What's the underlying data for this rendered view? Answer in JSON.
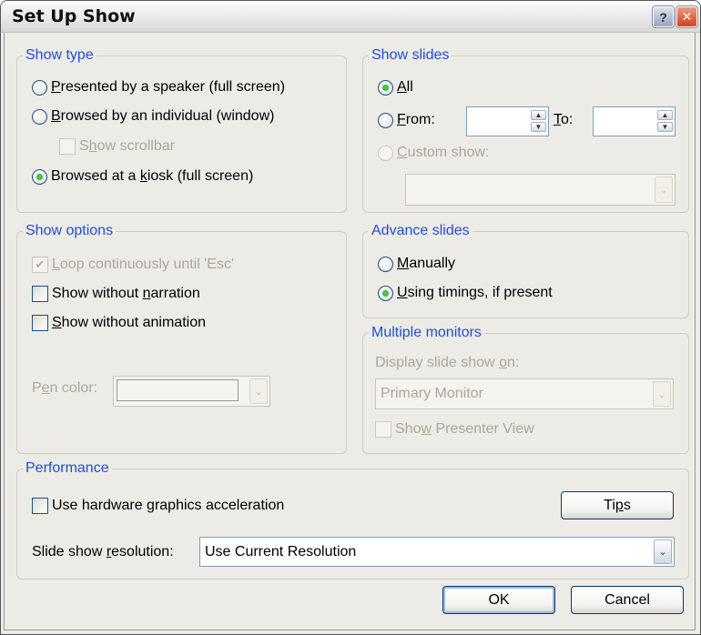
{
  "window": {
    "title": "Set Up Show",
    "help_icon": "?",
    "close_icon": "✕"
  },
  "show_type": {
    "title": "Show type",
    "options": [
      {
        "pre": "",
        "key": "P",
        "post": "resented by a speaker (full screen)",
        "checked": false
      },
      {
        "pre": "",
        "key": "B",
        "post": "rowsed by an individual (window)",
        "checked": false
      },
      {
        "pre": "Browsed at a ",
        "key": "k",
        "post": "iosk (full screen)",
        "checked": true
      }
    ],
    "scrollbar": {
      "pre": "S",
      "key": "h",
      "post": "ow scrollbar",
      "checked": false,
      "enabled": false
    }
  },
  "show_slides": {
    "title": "Show slides",
    "all": {
      "pre": "",
      "key": "A",
      "post": "ll",
      "checked": true
    },
    "from": {
      "pre": "",
      "key": "F",
      "post": "rom:",
      "checked": false,
      "value": ""
    },
    "to": {
      "pre": "",
      "key": "T",
      "post": "o:",
      "value": ""
    },
    "custom": {
      "pre": "",
      "key": "C",
      "post": "ustom show:",
      "enabled": false,
      "value": ""
    }
  },
  "show_options": {
    "title": "Show options",
    "loop": {
      "pre": "",
      "key": "L",
      "post": "oop continuously until 'Esc'",
      "checked": true,
      "enabled": false
    },
    "no_narration": {
      "pre": "Show without ",
      "key": "n",
      "post": "arration",
      "checked": false
    },
    "no_animation": {
      "pre": "",
      "key": "S",
      "post": "how without animation",
      "checked": false
    },
    "pen_color": {
      "pre": "P",
      "key": "e",
      "post": "n color:",
      "enabled": false
    }
  },
  "advance_slides": {
    "title": "Advance slides",
    "manually": {
      "pre": "",
      "key": "M",
      "post": "anually",
      "checked": false
    },
    "timings": {
      "pre": "",
      "key": "U",
      "post": "sing timings, if present",
      "checked": true
    }
  },
  "multiple_monitors": {
    "title": "Multiple monitors",
    "display_label": {
      "pre": "Display slide show ",
      "key": "o",
      "post": "n:"
    },
    "display_value": "Primary Monitor",
    "presenter_view": {
      "pre": "Sho",
      "key": "w",
      "post": " Presenter View",
      "checked": false,
      "enabled": false
    }
  },
  "performance": {
    "title": "Performance",
    "hw_accel": {
      "pre": "Use hardware ",
      "key": "g",
      "post": "raphics acceleration",
      "checked": false
    },
    "tips": {
      "pre": "Ti",
      "key": "p",
      "post": "s"
    },
    "resolution_label": {
      "pre": "Slide show ",
      "key": "r",
      "post": "esolution:"
    },
    "resolution_value": "Use Current Resolution"
  },
  "buttons": {
    "ok": "OK",
    "cancel": "Cancel"
  },
  "colors": {
    "group_title": "#1f4fcf",
    "dialog_bg": "#ecebe6",
    "radio_checked": "#21a121"
  }
}
